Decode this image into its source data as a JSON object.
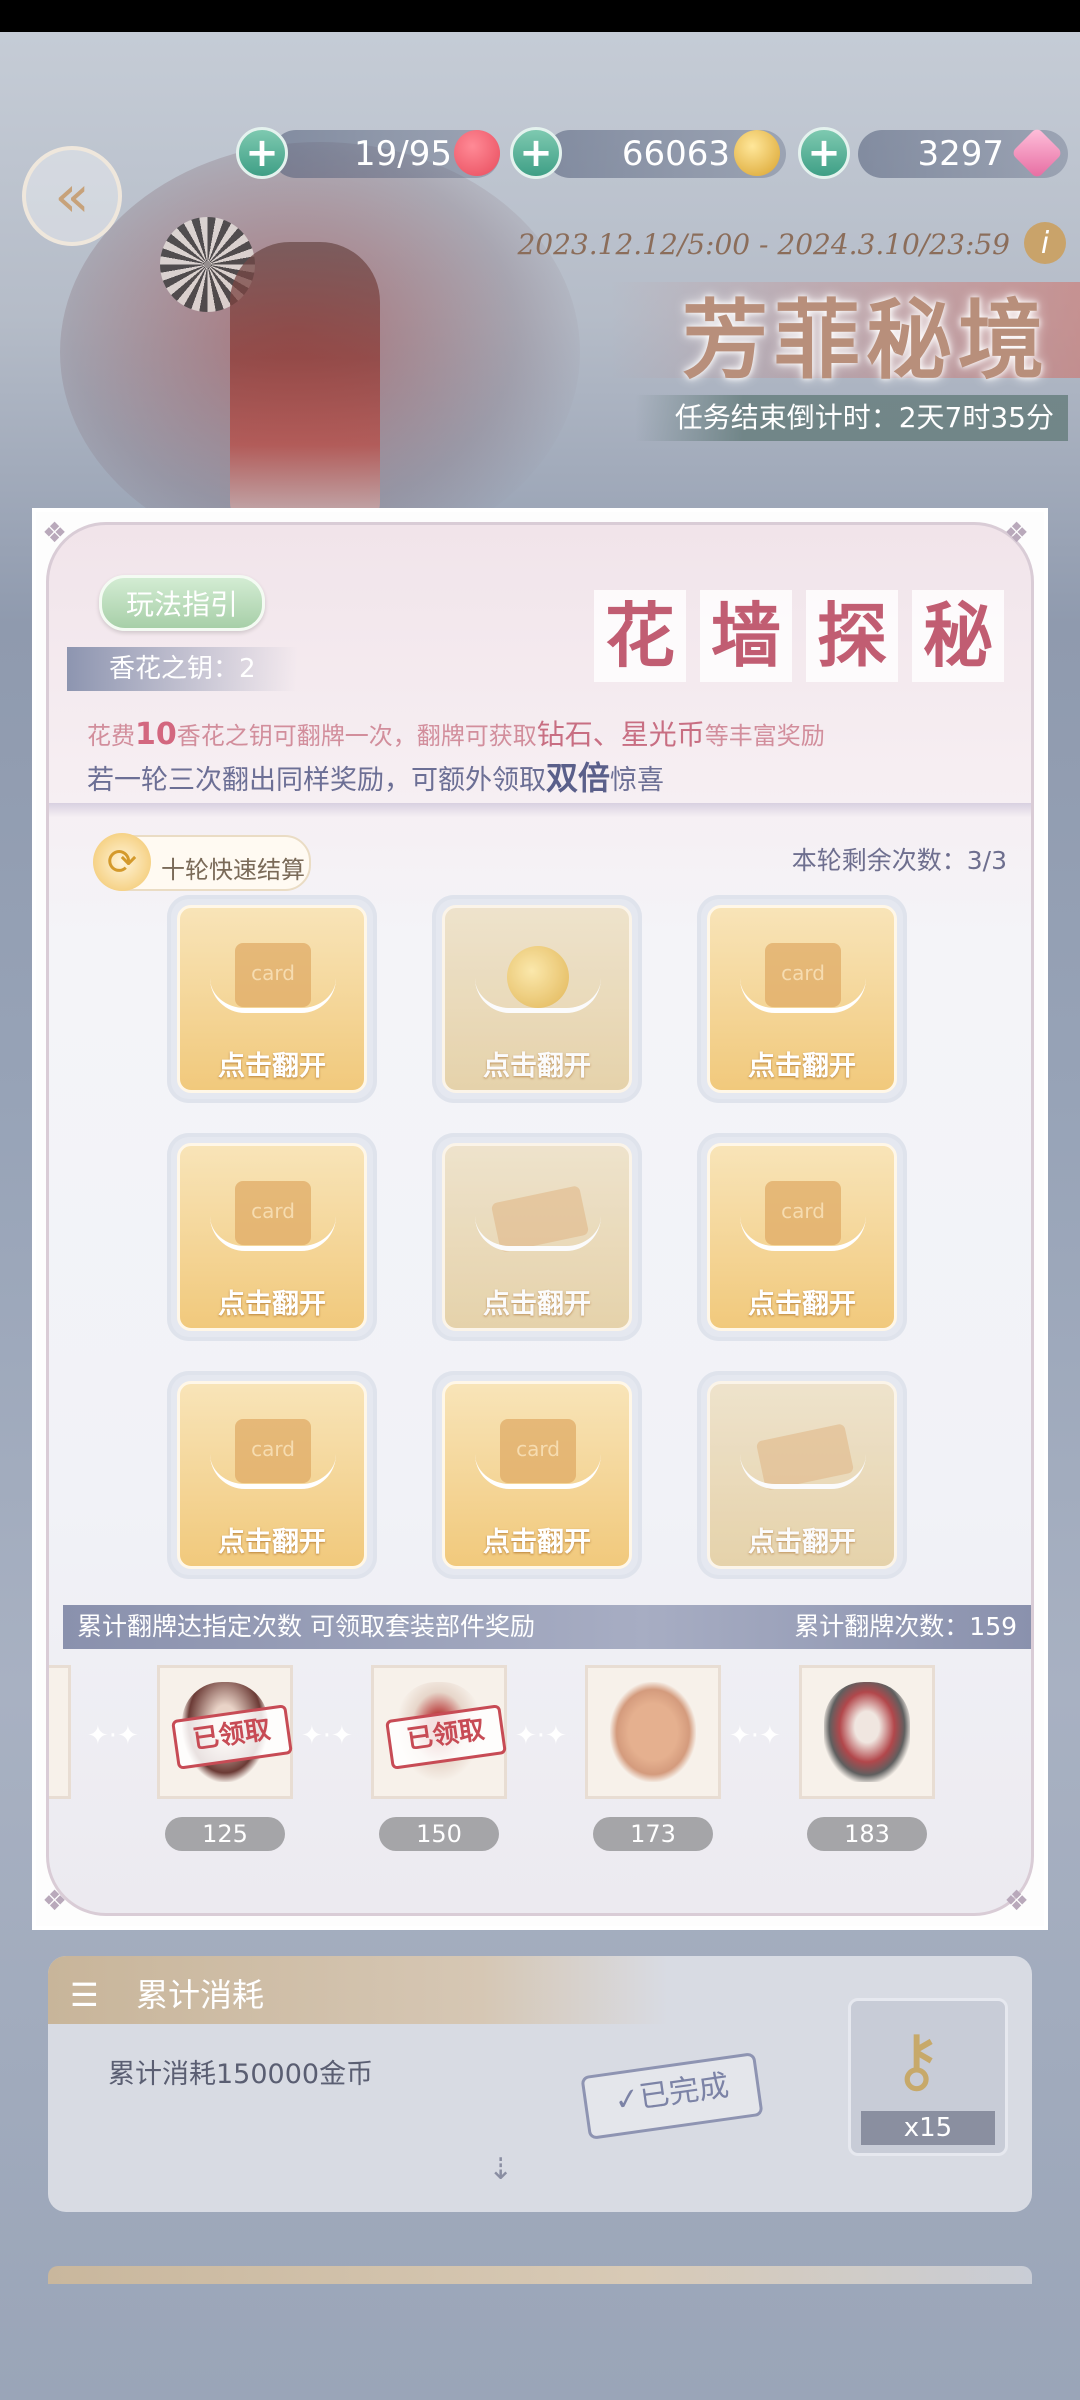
{
  "header": {
    "resources": [
      {
        "value": "19/95",
        "icon": "heart-icon",
        "color": "#e84b5c"
      },
      {
        "value": "66063",
        "icon": "gold-coin-icon",
        "color": "#e2b43a"
      },
      {
        "value": "3297",
        "icon": "diamond-icon",
        "color": "#e66aa0"
      }
    ],
    "plus_symbol": "+",
    "back_symbol": "«",
    "date_range": "2023.12.12/5:00 - 2024.3.10/23:59",
    "info_symbol": "i",
    "event_title": "芳菲秘境",
    "countdown": "任务结束倒计时：2天7时35分"
  },
  "modal": {
    "guide_button": "玩法指引",
    "title_chars": [
      "花",
      "墙",
      "探",
      "秘"
    ],
    "keys_label": "香花之钥：2",
    "desc1": {
      "a": "花费",
      "num": "10",
      "b": "香花之钥可翻牌一次，翻牌可获取",
      "c": "钻石、星光币",
      "d": "等丰富奖励"
    },
    "desc2": {
      "a": "若一轮三次翻出同样奖励，可额外领取",
      "b": "双倍",
      "c": "惊喜"
    },
    "quick_settle": "十轮快速结算",
    "remaining": "本轮剩余次数：3/3",
    "card_label": "点击翻开",
    "card_glyph_text": "card",
    "cards": [
      {
        "type": "card",
        "revealed": false
      },
      {
        "type": "coin",
        "revealed": true
      },
      {
        "type": "card",
        "revealed": false
      },
      {
        "type": "card",
        "revealed": false
      },
      {
        "type": "ticket",
        "revealed": true
      },
      {
        "type": "card",
        "revealed": false
      },
      {
        "type": "card",
        "revealed": false
      },
      {
        "type": "card",
        "revealed": false
      },
      {
        "type": "ticket",
        "revealed": true
      }
    ],
    "reward_bar_left": "累计翻牌达指定次数 可领取套装部件奖励",
    "reward_bar_right": "累计翻牌次数：159",
    "rewards": [
      {
        "count": "125",
        "claimed": true,
        "claimed_text": "已领取"
      },
      {
        "count": "150",
        "claimed": true,
        "claimed_text": "已领取"
      },
      {
        "count": "173",
        "claimed": false
      },
      {
        "count": "183",
        "claimed": false
      }
    ]
  },
  "task": {
    "header": "累计消耗",
    "menu_symbol": "☰",
    "description": "累计消耗150000金币",
    "status": "✓已完成",
    "expand_symbol": "⇣",
    "reward_icon": "key-icon",
    "reward_qty": "x15"
  }
}
